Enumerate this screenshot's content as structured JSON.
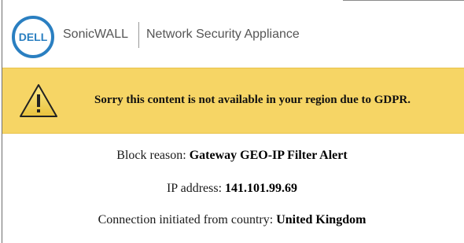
{
  "header": {
    "logo_text": "DELL",
    "brand": "SonicWALL",
    "product": "Network Security Appliance"
  },
  "alert": {
    "icon": "warning-triangle-icon",
    "message": "Sorry this content is not available in your region due to GDPR."
  },
  "details": {
    "block_reason_label": "Block reason:",
    "block_reason_value": "Gateway GEO-IP Filter Alert",
    "ip_label": "IP address:",
    "ip_value": "141.101.99.69",
    "country_label": "Connection initiated from country:",
    "country_value": "United Kingdom"
  },
  "colors": {
    "alert_background": "#f6d565",
    "dell_blue": "#2a7fc1",
    "text_gray": "#555555"
  }
}
